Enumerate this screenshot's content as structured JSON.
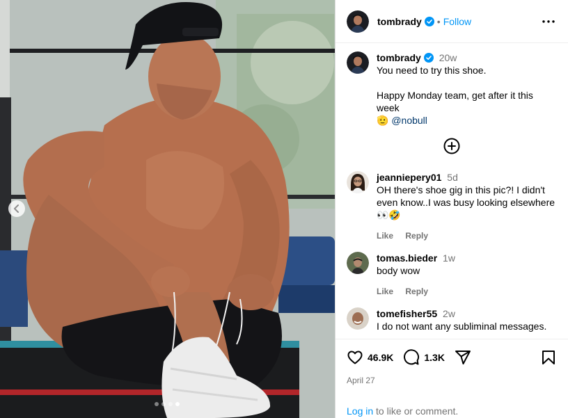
{
  "post": {
    "author": "tombrady",
    "follow_label": "Follow",
    "separator": "•",
    "caption_time": "20w",
    "caption_line1": "You need to try this shoe.",
    "caption_line2": "Happy Monday team, get after it this week",
    "caption_emoji": "🫡",
    "caption_mention": "@nobull",
    "date": "April 27"
  },
  "comments": [
    {
      "user": "jeanniepery01",
      "time": "5d",
      "text": "OH there's shoe gig in this pic?! I didn't even know..I was busy looking elsewhere 👀🤣",
      "like": "Like",
      "reply": "Reply"
    },
    {
      "user": "tomas.bieder",
      "time": "1w",
      "text": "body wow",
      "like": "Like",
      "reply": "Reply"
    },
    {
      "user": "tomefisher55",
      "time": "2w",
      "text": "I do not want any subliminal messages."
    }
  ],
  "stats": {
    "likes": "46.9K",
    "comments": "1.3K"
  },
  "login": {
    "link": "Log in",
    "rest": " to like or comment."
  },
  "icons": {
    "verified": "verified-badge-icon",
    "more": "more-options-icon",
    "load_more": "load-more-comments-icon",
    "like": "heart-icon",
    "comment": "comment-bubble-icon",
    "share": "share-paper-plane-icon",
    "save": "bookmark-icon",
    "prev": "chevron-left-icon"
  },
  "colors": {
    "accent": "#0095f6",
    "verified": "#0095f6",
    "muted": "#737373",
    "mention": "#00376b"
  },
  "carousel": {
    "slide_count": 4,
    "active_index": 3
  }
}
